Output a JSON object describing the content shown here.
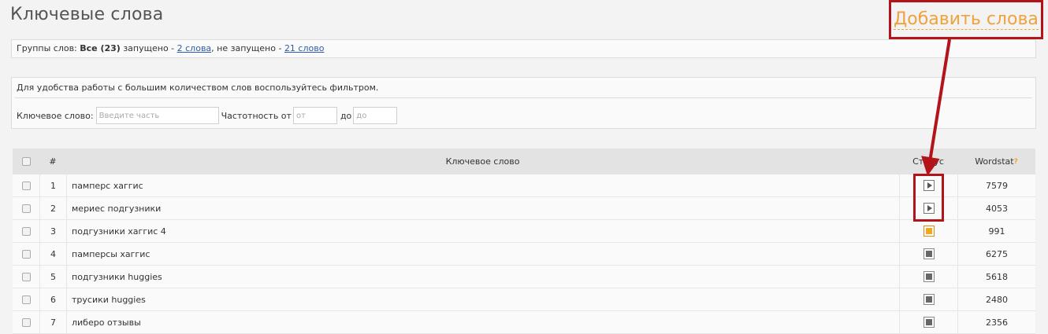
{
  "header": {
    "title": "Ключевые слова",
    "add_words_label": "Добавить слова"
  },
  "groups": {
    "label": "Группы слов:",
    "all": "Все (23)",
    "launched_text": "запущено -",
    "launched_link": "2 слова",
    "not_launched_text": ", не запущено -",
    "not_launched_link": "21 слово"
  },
  "filter": {
    "hint": "Для удобства работы с большим количеством слов воспользуйтесь фильтром.",
    "keyword_label": "Ключевое слово:",
    "keyword_placeholder": "Введите часть",
    "freq_label": "Частотность от",
    "from_placeholder": "от",
    "to_label": "до",
    "to_placeholder": "до"
  },
  "table": {
    "headers": {
      "num": "#",
      "keyword": "Ключевое слово",
      "status": "Статус",
      "wordstat": "Wordstat",
      "wordstat_hint": "?"
    },
    "rows": [
      {
        "num": "1",
        "keyword": "памперс хаггис",
        "status": "play",
        "wordstat": "7579"
      },
      {
        "num": "2",
        "keyword": "мериес подгузники",
        "status": "play",
        "wordstat": "4053"
      },
      {
        "num": "3",
        "keyword": "подгузники хаггис 4",
        "status": "pending",
        "wordstat": "991"
      },
      {
        "num": "4",
        "keyword": "памперсы хаггис",
        "status": "stopped",
        "wordstat": "6275"
      },
      {
        "num": "5",
        "keyword": "подгузники huggies",
        "status": "stopped",
        "wordstat": "5618"
      },
      {
        "num": "6",
        "keyword": "трусики huggies",
        "status": "stopped",
        "wordstat": "2480"
      },
      {
        "num": "7",
        "keyword": "либеро отзывы",
        "status": "stopped",
        "wordstat": "2356"
      }
    ]
  },
  "colors": {
    "accent_orange": "#f0a23b",
    "annotation_red": "#b3141b",
    "link_blue": "#2a5db0"
  }
}
